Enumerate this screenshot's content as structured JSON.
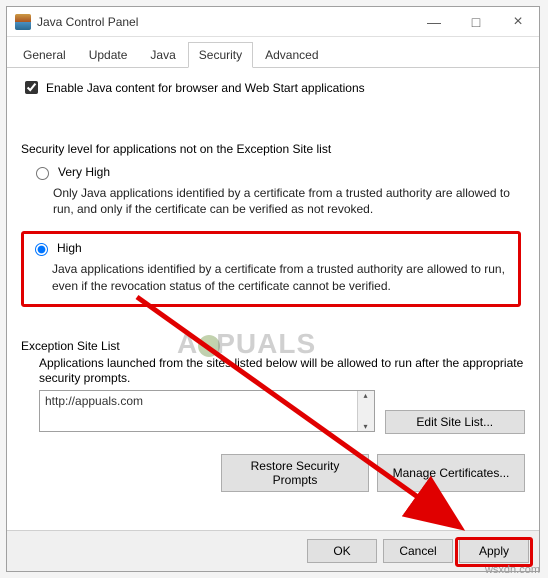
{
  "window": {
    "title": "Java Control Panel",
    "min": "—",
    "max": "□",
    "close": "×"
  },
  "tabs": {
    "items": [
      "General",
      "Update",
      "Java",
      "Security",
      "Advanced"
    ],
    "activeIndex": 3
  },
  "security": {
    "enable_label": "Enable Java content for browser and Web Start applications",
    "level_label": "Security level for applications not on the Exception Site list",
    "very_high": {
      "label": "Very High",
      "desc": "Only Java applications identified by a certificate from a trusted authority are allowed to run, and only if the certificate can be verified as not revoked."
    },
    "high": {
      "label": "High",
      "desc": "Java applications identified by a certificate from a trusted authority are allowed to run, even if the revocation status of the certificate cannot be verified."
    },
    "exception": {
      "title": "Exception Site List",
      "desc": "Applications launched from the sites listed below will be allowed to run after the appropriate security prompts.",
      "site0": "http://appuals.com",
      "edit_btn": "Edit Site List...",
      "restore_btn": "Restore Security Prompts",
      "manage_btn": "Manage Certificates..."
    }
  },
  "footer": {
    "ok": "OK",
    "cancel": "Cancel",
    "apply": "Apply"
  },
  "watermark": {
    "text": "A    PUALS",
    "source": "wsxdn.com"
  }
}
